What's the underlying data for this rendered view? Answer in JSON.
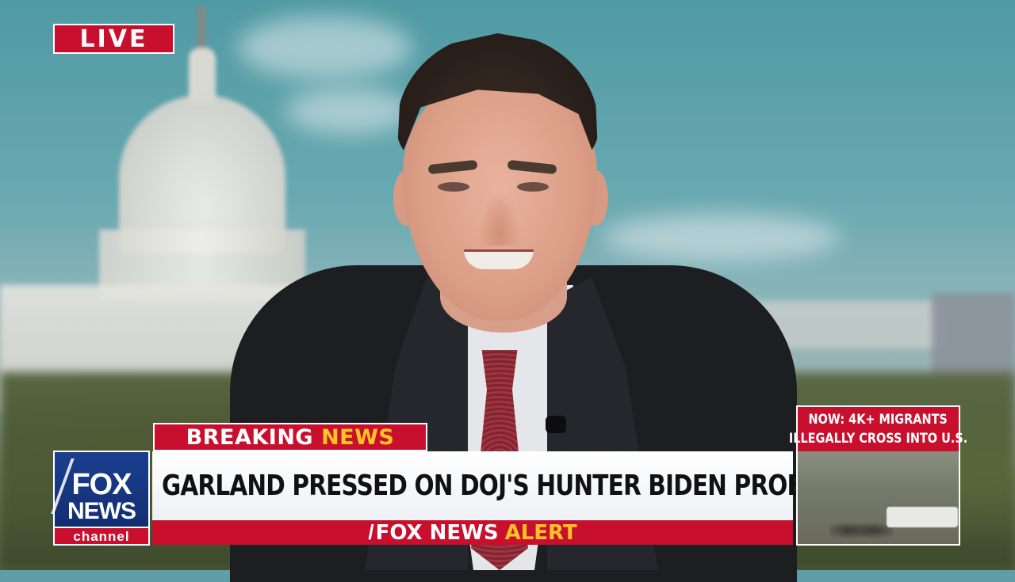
{
  "live_badge": "LIVE",
  "breaking_news": {
    "word1": "BREAKING",
    "word2": "NEWS"
  },
  "logo": {
    "fox": "FOX",
    "news": "NEWS",
    "channel": "channel"
  },
  "headline": "GARLAND PRESSED ON DOJ'S HUNTER BIDEN PROBE",
  "alert": {
    "word1": "FOX NEWS",
    "word2": "ALERT"
  },
  "side_panel": {
    "line1": "NOW: 4K+ MIGRANTS",
    "line2": "ILLEGALLY CROSS INTO U.S."
  },
  "colors": {
    "fox_red": "#c8102e",
    "fox_yellow": "#ffc425",
    "fox_blue": "#1b3f8f"
  }
}
